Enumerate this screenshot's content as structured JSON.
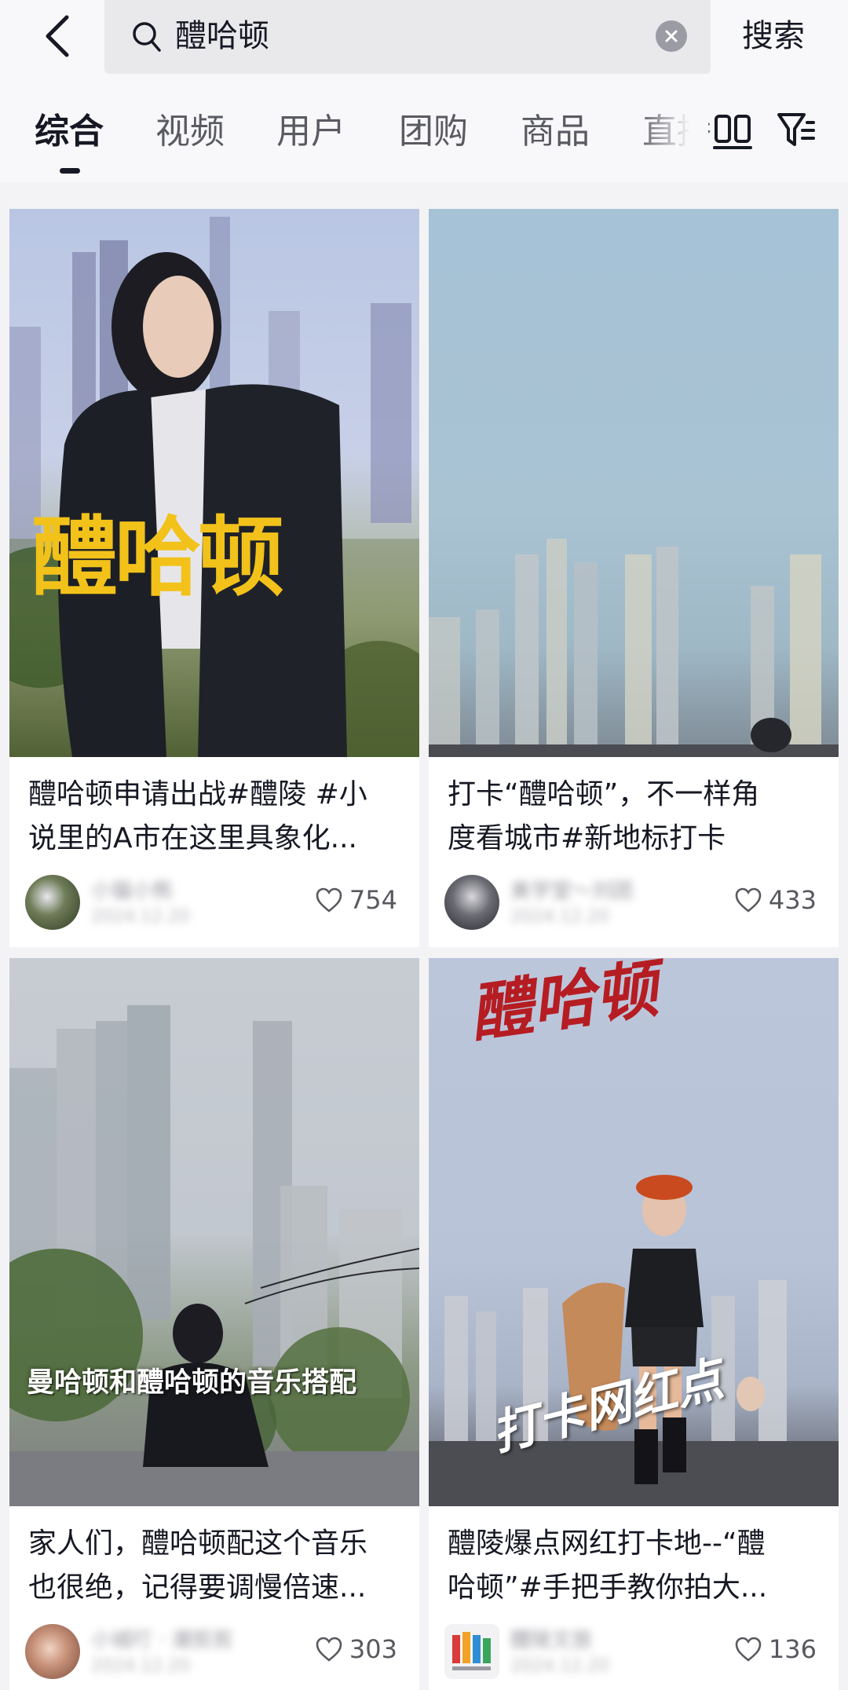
{
  "header": {
    "search_query": "醴哈顿",
    "search_button": "搜索"
  },
  "tabs": [
    "综合",
    "视频",
    "用户",
    "团购",
    "商品",
    "直播"
  ],
  "active_tab": "综合",
  "cards": [
    {
      "overlay_text": "醴哈顿",
      "title_line1": "醴哈顿申请出战#醴陵 #小",
      "title_line2": "说里的A市在这里具象化...",
      "author": "小猫小熊",
      "date": "2024.12.20",
      "likes": "754"
    },
    {
      "overlay_text": "",
      "title_line1": "打卡“醴哈顿”，不一样角",
      "title_line2": "度看城市#新地标打卡",
      "author": "美学堂～刘团",
      "date": "2024.12.20",
      "likes": "433"
    },
    {
      "overlay_text": "曼哈顿和醴哈顿的音乐搭配",
      "title_line1": "家人们，醴哈顿配这个音乐",
      "title_line2": "也很绝，记得要调慢倍速...",
      "author": "小城叮 · 潮剪剪",
      "date": "2024.12.20",
      "likes": "303"
    },
    {
      "overlay_text": "醴哈顿",
      "overlay_text_2": "打卡网红点",
      "title_line1": "醴陵爆点网红打卡地--“醴",
      "title_line2": "哈顿”#手把手教你拍大...",
      "author": "醴陵文旅",
      "date": "2024.12.20",
      "likes": "136"
    }
  ],
  "colors": {
    "overlay_yellow": "#f2c21a",
    "overlay_red": "#b51d22",
    "text_primary": "#161823"
  }
}
